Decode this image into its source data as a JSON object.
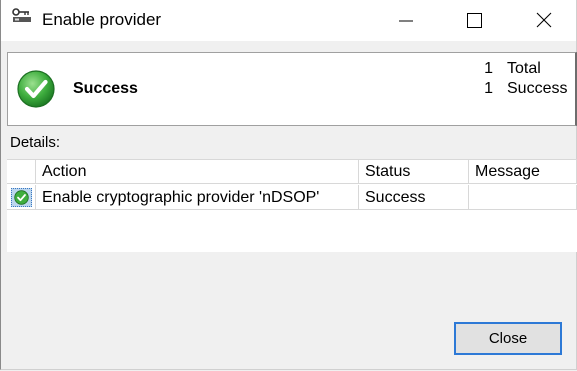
{
  "window": {
    "title": "Enable provider"
  },
  "summary": {
    "status": "Success",
    "counts": [
      {
        "value": "1",
        "label": "Total"
      },
      {
        "value": "1",
        "label": "Success"
      }
    ]
  },
  "details": {
    "label": "Details:",
    "columns": [
      "Action",
      "Status",
      "Message"
    ],
    "rows": [
      {
        "action": "Enable cryptographic provider 'nDSOP'",
        "status": "Success",
        "message": ""
      }
    ]
  },
  "buttons": {
    "close": "Close"
  },
  "colors": {
    "success_green": "#3fae3f",
    "accent_border": "#2d79d6",
    "selected_row": "#bcd6ee"
  }
}
